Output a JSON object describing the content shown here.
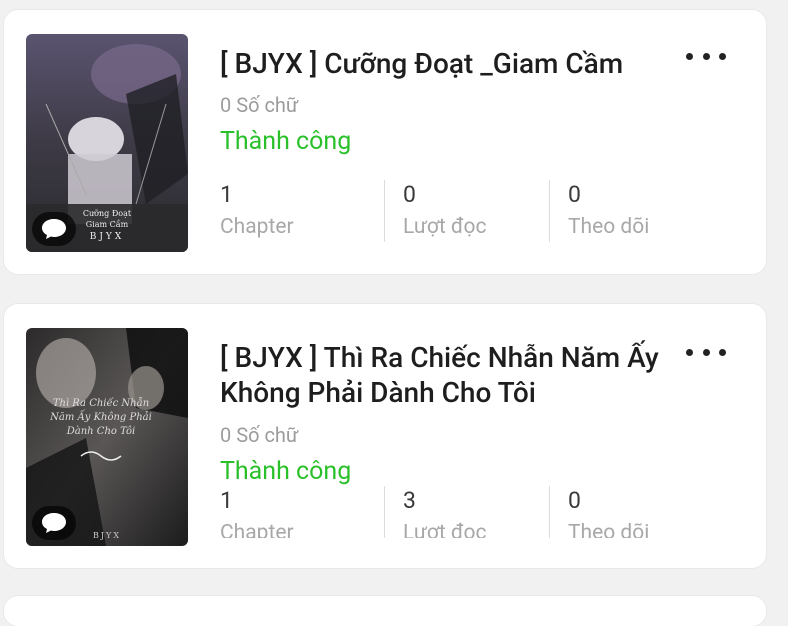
{
  "stories": [
    {
      "title": "[ BJYX ] Cưỡng Đoạt _Giam Cầm",
      "title_line2": "",
      "word_count": "0 Số chữ",
      "status": "Thành công",
      "stats": [
        {
          "value": "1",
          "label": "Chapter"
        },
        {
          "value": "0",
          "label": "Lượt đọc"
        },
        {
          "value": "0",
          "label": "Theo dõi"
        }
      ],
      "cover_text": {
        "line1": "Cưỡng Đoạt",
        "line2": "Giam Cầm",
        "line3": "BJYX"
      }
    },
    {
      "title": "[ BJYX ] Thì Ra Chiếc Nhẫn Năm Ấy",
      "title_line2": "Không Phải Dành Cho Tôi",
      "word_count": "0 Số chữ",
      "status": "Thành công",
      "stats": [
        {
          "value": "1",
          "label": "Chapter"
        },
        {
          "value": "3",
          "label": "Lượt đọc"
        },
        {
          "value": "0",
          "label": "Theo dõi"
        }
      ],
      "cover_text": {
        "line1": "Thì Ra Chiếc Nhẫn",
        "line2": "Năm Ấy Không Phải",
        "line3": "Dành Cho Tôi",
        "line4": "BJYX"
      }
    }
  ],
  "colors": {
    "status": "#2ac02a",
    "background": "#f1f1f1",
    "card": "#ffffff"
  }
}
